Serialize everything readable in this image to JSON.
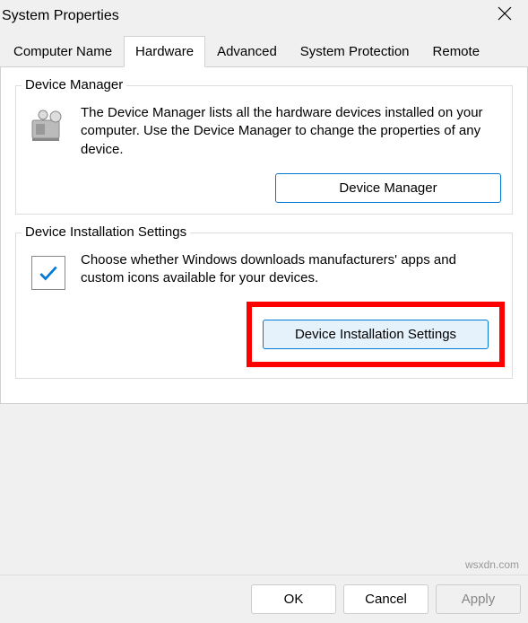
{
  "window": {
    "title": "System Properties"
  },
  "tabs": {
    "computer_name": "Computer Name",
    "hardware": "Hardware",
    "advanced": "Advanced",
    "system_protection": "System Protection",
    "remote": "Remote"
  },
  "groups": {
    "device_manager": {
      "title": "Device Manager",
      "description": "The Device Manager lists all the hardware devices installed on your computer. Use the Device Manager to change the properties of any device.",
      "button": "Device Manager"
    },
    "installation": {
      "title": "Device Installation Settings",
      "description": "Choose whether Windows downloads manufacturers' apps and custom icons available for your devices.",
      "button": "Device Installation Settings"
    }
  },
  "footer": {
    "ok": "OK",
    "cancel": "Cancel",
    "apply": "Apply"
  },
  "watermark": "wsxdn.com"
}
